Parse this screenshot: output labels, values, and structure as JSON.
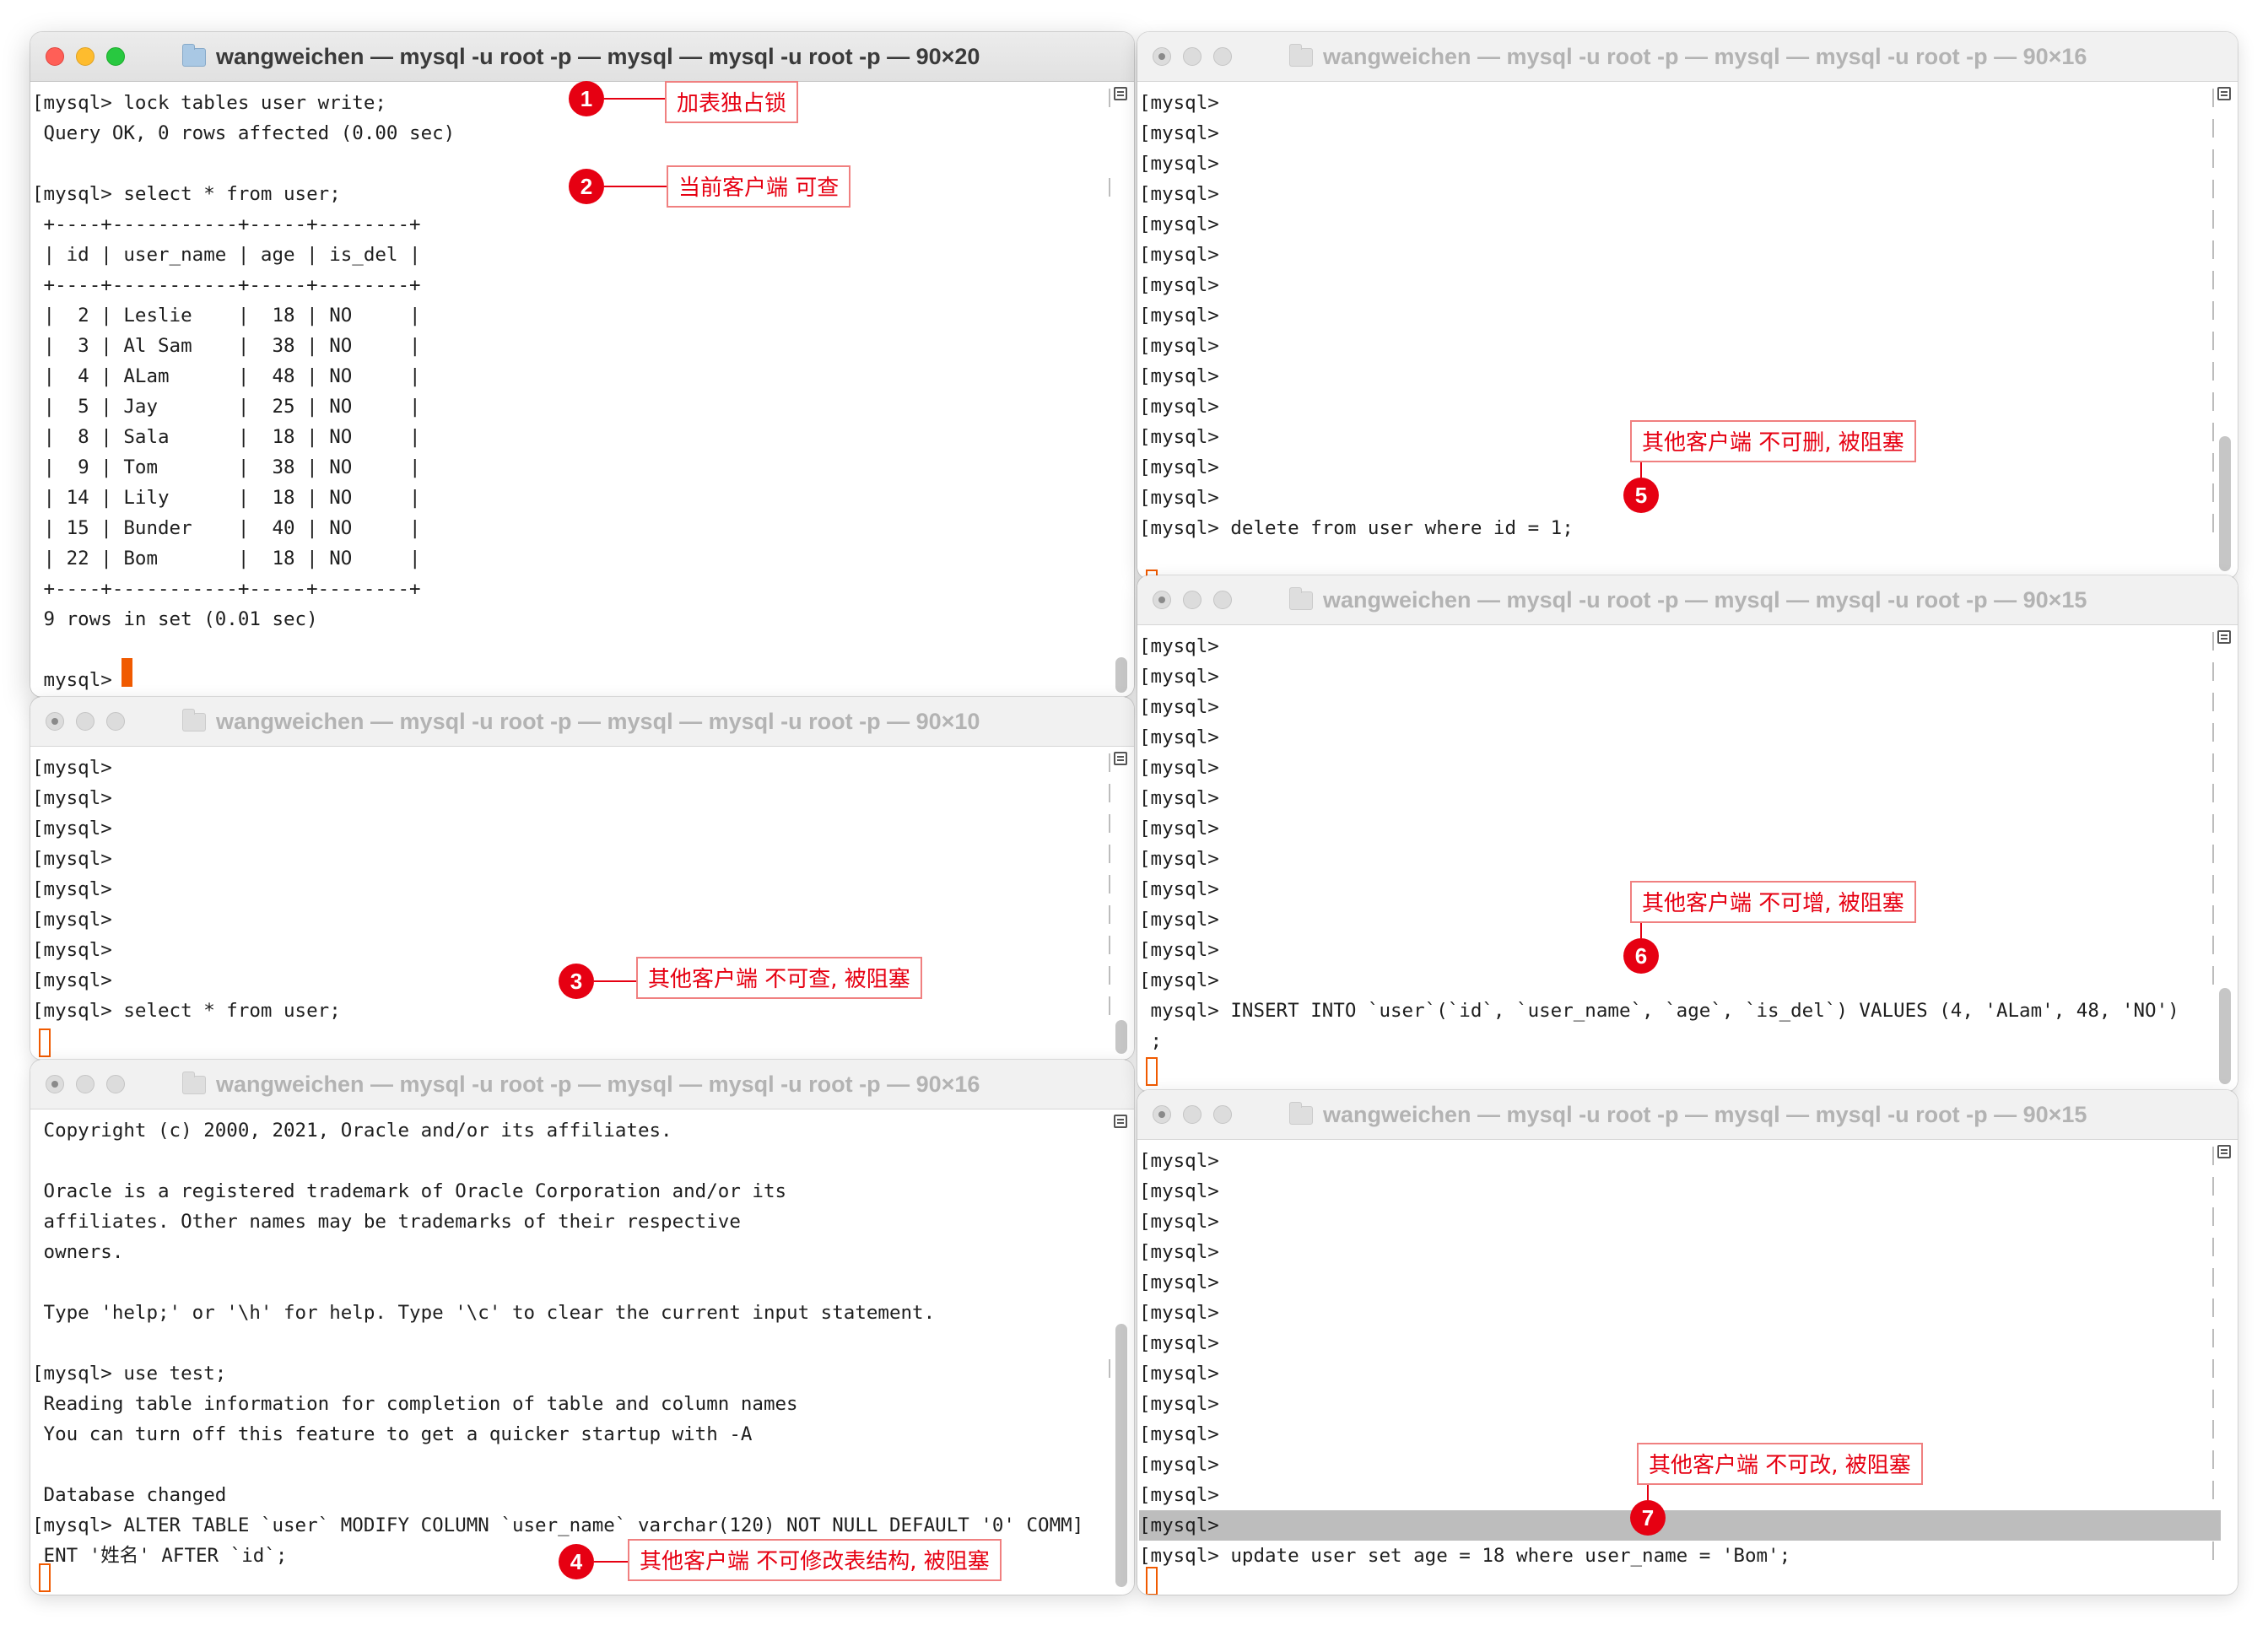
{
  "windows": {
    "w1": {
      "title": "wangweichen — mysql -u root -p — mysql — mysql -u root -p — 90×20",
      "lines": [
        "[mysql> lock tables user write;",
        " Query OK, 0 rows affected (0.00 sec)",
        "",
        "[mysql> select * from user;",
        " +----+-----------+-----+--------+",
        " | id | user_name | age | is_del |",
        " +----+-----------+-----+--------+",
        " |  2 | Leslie    |  18 | NO     |",
        " |  3 | Al Sam    |  38 | NO     |",
        " |  4 | ALam      |  48 | NO     |",
        " |  5 | Jay       |  25 | NO     |",
        " |  8 | Sala      |  18 | NO     |",
        " |  9 | Tom       |  38 | NO     |",
        " | 14 | Lily      |  18 | NO     |",
        " | 15 | Bunder    |  40 | NO     |",
        " | 22 | Bom       |  18 | NO     |",
        " +----+-----------+-----+--------+",
        " 9 rows in set (0.01 sec)",
        "",
        " mysql> "
      ]
    },
    "w2": {
      "title": "wangweichen — mysql -u root -p — mysql — mysql -u root -p — 90×10",
      "lines": [
        "[mysql>",
        "[mysql>",
        "[mysql>",
        "[mysql>",
        "[mysql>",
        "[mysql>",
        "[mysql>",
        "[mysql>",
        "[mysql> select * from user;"
      ]
    },
    "w3": {
      "title": "wangweichen — mysql -u root -p — mysql — mysql -u root -p — 90×16",
      "lines": [
        " Copyright (c) 2000, 2021, Oracle and/or its affiliates.",
        "",
        " Oracle is a registered trademark of Oracle Corporation and/or its",
        " affiliates. Other names may be trademarks of their respective",
        " owners.",
        "",
        " Type 'help;' or '\\h' for help. Type '\\c' to clear the current input statement.",
        "",
        "[mysql> use test;",
        " Reading table information for completion of table and column names",
        " You can turn off this feature to get a quicker startup with -A",
        "",
        " Database changed",
        "[mysql> ALTER TABLE `user` MODIFY COLUMN `user_name` varchar(120) NOT NULL DEFAULT '0' COMM]",
        " ENT '姓名' AFTER `id`;"
      ]
    },
    "w4": {
      "title": "wangweichen — mysql -u root -p — mysql — mysql -u root -p — 90×16",
      "lines": [
        "[mysql>",
        "[mysql>",
        "[mysql>",
        "[mysql>",
        "[mysql>",
        "[mysql>",
        "[mysql>",
        "[mysql>",
        "[mysql>",
        "[mysql>",
        "[mysql>",
        "[mysql>",
        "[mysql>",
        "[mysql>",
        "[mysql> delete from user where id = 1;"
      ]
    },
    "w5": {
      "title": "wangweichen — mysql -u root -p — mysql — mysql -u root -p — 90×15",
      "lines": [
        "[mysql>",
        "[mysql>",
        "[mysql>",
        "[mysql>",
        "[mysql>",
        "[mysql>",
        "[mysql>",
        "[mysql>",
        "[mysql>",
        "[mysql>",
        "[mysql>",
        "[mysql>",
        " mysql> INSERT INTO `user`(`id`, `user_name`, `age`, `is_del`) VALUES (4, 'ALam', 48, 'NO')",
        " ;"
      ]
    },
    "w6": {
      "title": "wangweichen — mysql -u root -p — mysql — mysql -u root -p — 90×15",
      "lines": [
        "[mysql>",
        "[mysql>",
        "[mysql>",
        "[mysql>",
        "[mysql>",
        "[mysql>",
        "[mysql>",
        "[mysql>",
        "[mysql>",
        "[mysql>",
        "[mysql>",
        "[mysql>",
        "[mysql>",
        "[mysql> update user set age = 18 where user_name = 'Bom';"
      ]
    }
  },
  "annotations": [
    {
      "num": "1",
      "text": "加表独占锁"
    },
    {
      "num": "2",
      "text": "当前客户端 可查"
    },
    {
      "num": "3",
      "text": "其他客户端 不可查, 被阻塞"
    },
    {
      "num": "4",
      "text": "其他客户端 不可修改表结构, 被阻塞"
    },
    {
      "num": "5",
      "text": "其他客户端 不可删, 被阻塞"
    },
    {
      "num": "6",
      "text": "其他客户端 不可增, 被阻塞"
    },
    {
      "num": "7",
      "text": "其他客户端 不可改, 被阻塞"
    }
  ],
  "colors": {
    "annotation_red": "#e60012",
    "cursor_orange": "#f05a00",
    "highlight_gray": "#bdbdbd"
  }
}
